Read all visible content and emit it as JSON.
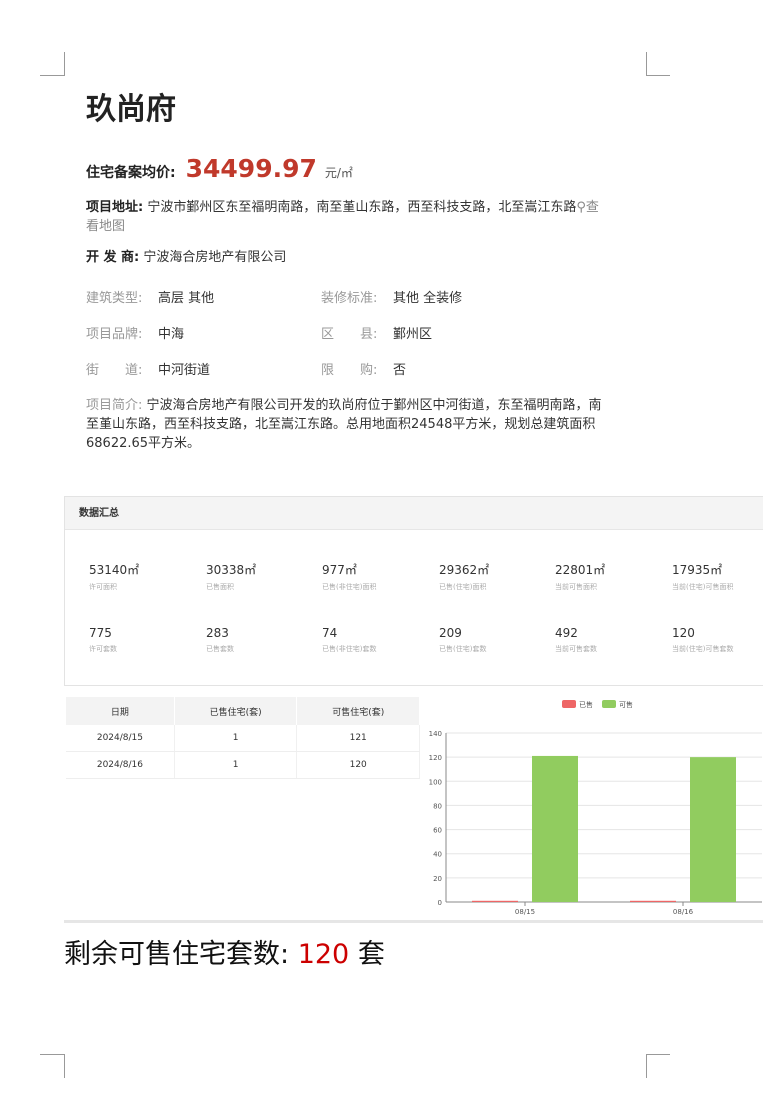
{
  "project": {
    "name": "玖尚府",
    "price_label": "住宅备案均价:",
    "price_value": "34499.97",
    "price_unit": "元/㎡",
    "address_label": "项目地址:",
    "address_value": "宁波市鄞州区东至福明南路，南至堇山东路，西至科技支路，北至嵩江东路",
    "map_link": "查看地图",
    "developer_label": "开 发 商:",
    "developer_value": "宁波海合房地产有限公司"
  },
  "attributes": [
    {
      "label": "建筑类型:",
      "value": "高层 其他"
    },
    {
      "label": "装修标准:",
      "value": "其他 全装修"
    },
    {
      "label": "项目品牌:",
      "value": "中海"
    },
    {
      "label": "区　　县:",
      "value": "鄞州区"
    },
    {
      "label": "街　　道:",
      "value": "中河街道"
    },
    {
      "label": "限　　购:",
      "value": "否"
    }
  ],
  "intro": {
    "label": "项目简介:",
    "text": "宁波海合房地产有限公司开发的玖尚府位于鄞州区中河街道，东至福明南路，南至堇山东路，西至科技支路，北至嵩江东路。总用地面积24548平方米，规划总建筑面积68622.65平方米。"
  },
  "summary": {
    "title": "数据汇总",
    "stats_row1": [
      {
        "value": "53140㎡",
        "label": "许可面积"
      },
      {
        "value": "30338㎡",
        "label": "已售面积"
      },
      {
        "value": "977㎡",
        "label": "已售(非住宅)面积"
      },
      {
        "value": "29362㎡",
        "label": "已售(住宅)面积"
      },
      {
        "value": "22801㎡",
        "label": "当前可售面积"
      },
      {
        "value": "17935㎡",
        "label": "当前(住宅)可售面积"
      }
    ],
    "stats_row2": [
      {
        "value": "775",
        "label": "许可套数"
      },
      {
        "value": "283",
        "label": "已售套数"
      },
      {
        "value": "74",
        "label": "已售(非住宅)套数"
      },
      {
        "value": "209",
        "label": "已售(住宅)套数"
      },
      {
        "value": "492",
        "label": "当前可售套数"
      },
      {
        "value": "120",
        "label": "当前(住宅)可售套数"
      }
    ]
  },
  "table": {
    "headers": [
      "日期",
      "已售住宅(套)",
      "可售住宅(套)"
    ],
    "rows": [
      [
        "2024/8/15",
        "1",
        "121"
      ],
      [
        "2024/8/16",
        "1",
        "120"
      ]
    ]
  },
  "chart_data": {
    "type": "bar",
    "categories": [
      "08/15",
      "08/16"
    ],
    "series": [
      {
        "name": "已售",
        "values": [
          1,
          1
        ],
        "color": "#ee6666"
      },
      {
        "name": "可售",
        "values": [
          121,
          120
        ],
        "color": "#91cc5f"
      }
    ],
    "ylim": [
      0,
      140
    ],
    "yticks": [
      0,
      20,
      40,
      60,
      80,
      100,
      120,
      140
    ],
    "grid": true,
    "legend": "top-center"
  },
  "remaining": {
    "label": "剩余可售住宅套数:",
    "value": "120",
    "unit": "套"
  }
}
